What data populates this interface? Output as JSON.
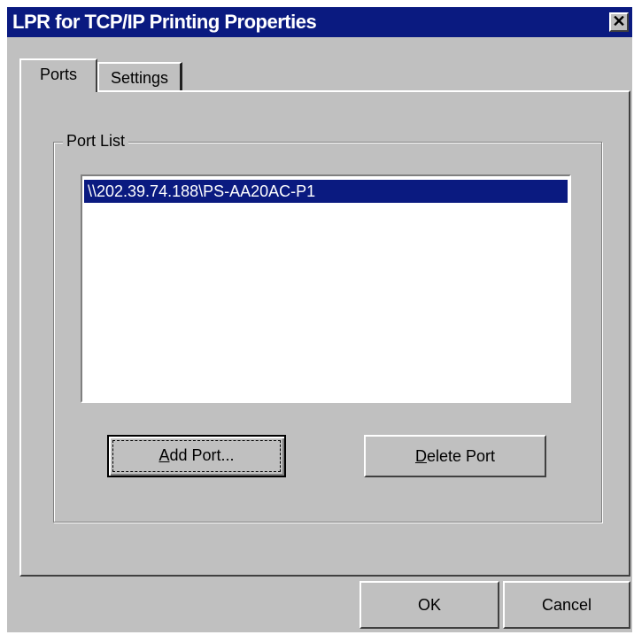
{
  "window": {
    "title": "LPR for TCP/IP Printing Properties",
    "close_label": "✕"
  },
  "tabs": [
    {
      "label": "Ports",
      "selected": true
    },
    {
      "label": "Settings",
      "selected": false
    }
  ],
  "port_list": {
    "label": "Port List",
    "items": [
      "\\\\202.39.74.188\\PS-AA20AC-P1"
    ],
    "selected_index": 0
  },
  "buttons": {
    "add_port": {
      "mnemonic": "A",
      "rest": "dd Port..."
    },
    "delete_port": {
      "mnemonic": "D",
      "rest": "elete Port"
    },
    "ok": "OK",
    "cancel": "Cancel"
  },
  "colors": {
    "title_bar": "#0a1a80",
    "selection": "#0a1a80",
    "face": "#c0c0c0"
  }
}
